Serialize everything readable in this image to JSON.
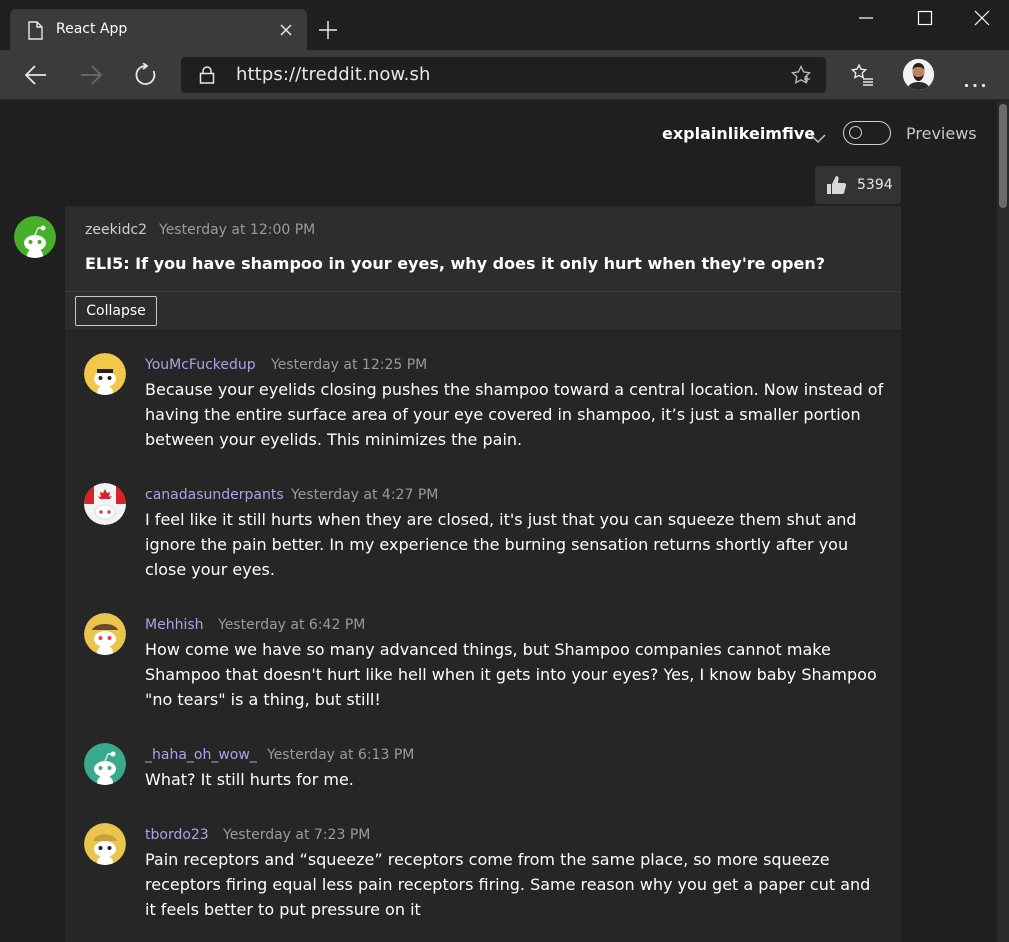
{
  "browser": {
    "tab_title": "React App",
    "url": "https://treddit.now.sh"
  },
  "header": {
    "subreddit": "explainlikeimfive",
    "previews_label": "Previews",
    "previews_enabled": false
  },
  "post": {
    "votes": "5394",
    "author": "zeekidc2",
    "time": "Yesterday at 12:00 PM",
    "title": "ELI5: If you have shampoo in your eyes, why does it only hurt when they're open?",
    "collapse_label": "Collapse"
  },
  "comments": [
    {
      "author": "YouMcFuckedup",
      "time": "Yesterday at 12:25 PM",
      "body": "Because your eyelids closing pushes the shampoo toward a central location. Now instead of having the entire surface area of your eye covered in shampoo, it’s just a smaller portion between your eyelids. This minimizes the pain."
    },
    {
      "author": "canadasunderpants",
      "time": "Yesterday at 4:27 PM",
      "body": "I feel like it still hurts when they are closed, it's just that you can squeeze them shut and ignore the pain better. In my experience the burning sensation returns shortly after you close your eyes."
    },
    {
      "author": "Mehhish",
      "time": "Yesterday at 6:42 PM",
      "body": "How come we have so many advanced things, but Shampoo companies cannot make Shampoo that doesn't hurt like hell when it gets into your eyes? Yes, I know baby Shampoo \"no tears\" is a thing, but still!"
    },
    {
      "author": "_haha_oh_wow_",
      "time": "Yesterday at 6:13 PM",
      "body": "What? It still hurts for me."
    },
    {
      "author": "tbordo23",
      "time": "Yesterday at 7:23 PM",
      "body": "Pain receptors and “squeeze” receptors come from the same place, so more squeeze receptors firing equal less pain receptors firing. Same reason why you get a paper cut and it feels better to put pressure on it"
    }
  ],
  "colors": {
    "accent_username": "#a9a4e4",
    "op_avatar": "#46b02a",
    "avatar_yellow": "#f2c84b",
    "avatar_teal": "#3aaa8c"
  }
}
